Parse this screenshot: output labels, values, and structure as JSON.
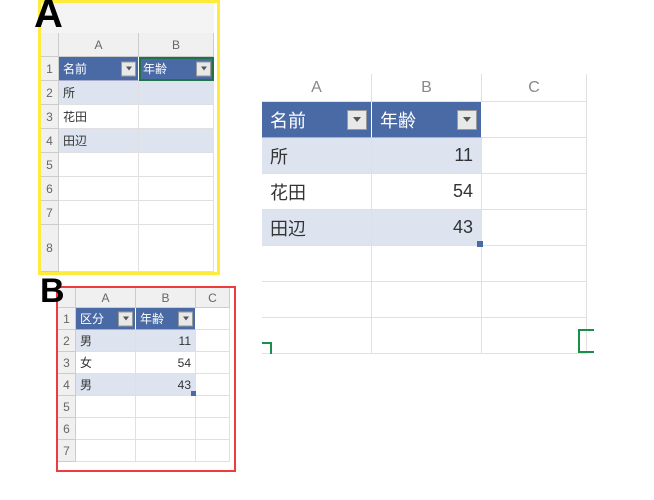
{
  "labels": {
    "A": "A",
    "B": "B"
  },
  "colHeaders": {
    "A": "A",
    "B": "B",
    "C": "C"
  },
  "rowNums": {
    "r1": "1",
    "r2": "2",
    "r3": "3",
    "r4": "4",
    "r5": "5",
    "r6": "6",
    "r7": "7",
    "r8": "8"
  },
  "panelA": {
    "headers": {
      "name": "名前",
      "age": "年齢"
    },
    "rows": [
      {
        "name": "所",
        "age": ""
      },
      {
        "name": "花田",
        "age": ""
      },
      {
        "name": "田辺",
        "age": ""
      }
    ]
  },
  "panelB": {
    "headers": {
      "category": "区分",
      "age": "年齢"
    },
    "rows": [
      {
        "category": "男",
        "age": 11
      },
      {
        "category": "女",
        "age": 54
      },
      {
        "category": "男",
        "age": 43
      }
    ]
  },
  "panelC": {
    "headers": {
      "name": "名前",
      "age": "年齢"
    },
    "rows": [
      {
        "name": "所",
        "age": 11
      },
      {
        "name": "花田",
        "age": 54
      },
      {
        "name": "田辺",
        "age": 43
      }
    ]
  }
}
